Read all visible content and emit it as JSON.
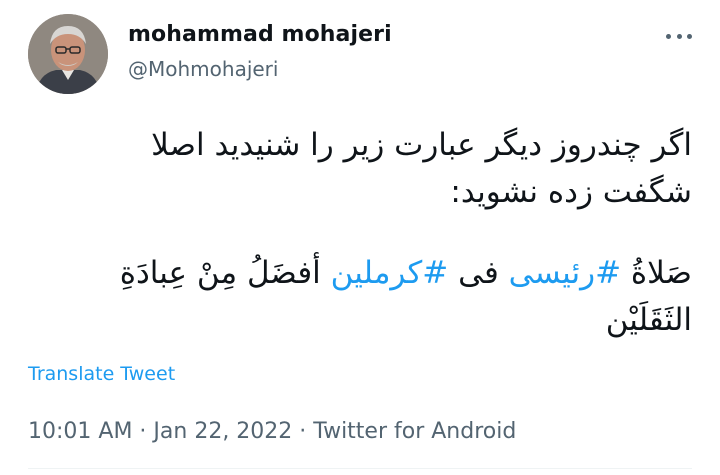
{
  "author": {
    "name": "mohammad mohajeri",
    "handle": "@Mohmohajeri"
  },
  "tweet": {
    "line1": "اگر چندروز دیگر عبارت زیر را شنیدید اصلا",
    "line2": "شگفت زده نشوید:",
    "quote_part1": "صَلاةُ ",
    "hashtag1": "#رئیسی",
    "quote_part2": " فی ",
    "hashtag2": "#کرملین",
    "quote_part3": " أفضَلُ مِنْ عِبادَةِ الثَقَلَیْن"
  },
  "actions": {
    "translate_label": "Translate Tweet",
    "more_icon": "more-horizontal-icon"
  },
  "meta": {
    "time": "10:01 AM",
    "separator": " · ",
    "date": "Jan 22, 2022",
    "source": "Twitter for Android"
  },
  "colors": {
    "link": "#1d9bf0",
    "secondary": "#536471",
    "text": "#0f1419"
  }
}
